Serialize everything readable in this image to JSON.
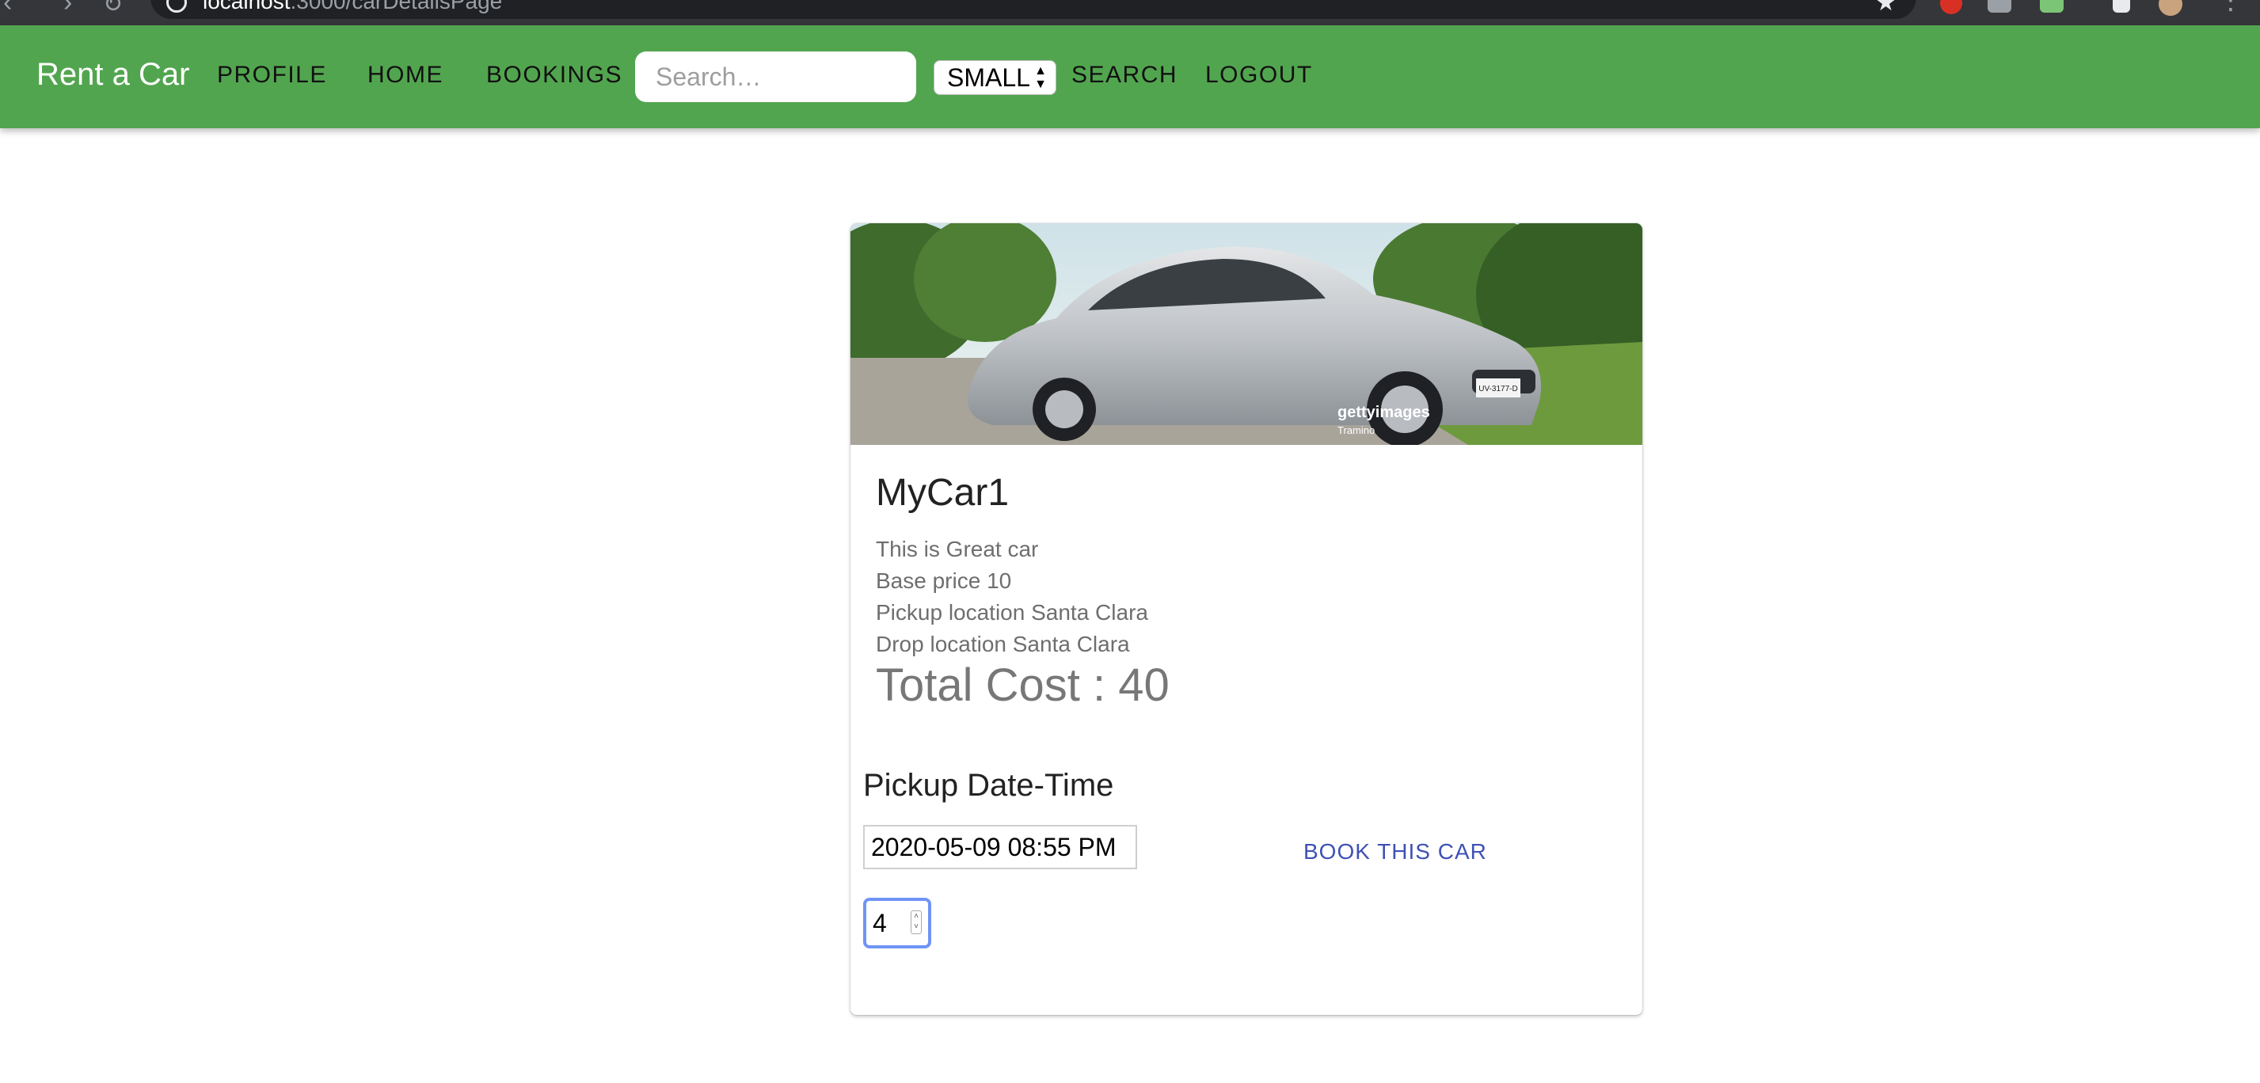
{
  "browser": {
    "url_host": "localhost",
    "url_rest": ":3000/carDetailsPage"
  },
  "navbar": {
    "brand": "Rent a Car",
    "profile_label": "PROFILE",
    "home_label": "HOME",
    "bookings_label": "BOOKINGS",
    "search_placeholder": "Search…",
    "size_select_value": "SMALL",
    "search_label": "SEARCH",
    "logout_label": "LOGOUT"
  },
  "car": {
    "image_watermark": "gettyimages",
    "image_credit": "Tramino",
    "plate": "UV-3177-D",
    "title": "MyCar1",
    "description": "This is Great car",
    "base_price": "Base price 10",
    "pickup_location": "Pickup location Santa Clara",
    "drop_location": "Drop location Santa Clara",
    "total_cost": "Total Cost : 40"
  },
  "booking": {
    "pickup_label": "Pickup Date-Time",
    "pickup_value": "2020-05-09 08:55 PM",
    "book_label": "BOOK THIS CAR",
    "days_value": "4"
  },
  "colors": {
    "appbar": "#52a54f",
    "book_button": "#3f51b5",
    "focus_ring": "#6f94f6"
  }
}
